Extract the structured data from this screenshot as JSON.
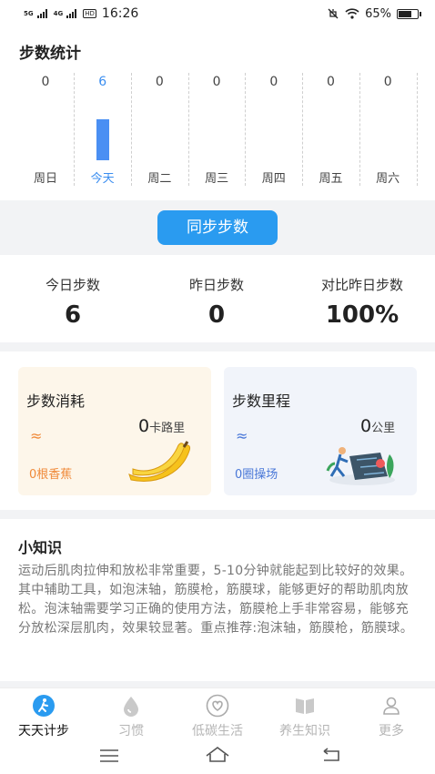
{
  "status_bar": {
    "signal1": "5G",
    "signal2": "4G",
    "hd": "HD",
    "time": "16:26",
    "battery": "65%"
  },
  "steps_section": {
    "title": "步数统计"
  },
  "chart_data": {
    "type": "bar",
    "categories": [
      "周日",
      "今天",
      "周二",
      "周三",
      "周四",
      "周五",
      "周六"
    ],
    "values": [
      0,
      6,
      0,
      0,
      0,
      0,
      0
    ],
    "value_labels": [
      "0",
      "6",
      "0",
      "0",
      "0",
      "0",
      "0"
    ],
    "active_index": 1,
    "accent": "#4a8ff3"
  },
  "sync": {
    "label": "同步步数"
  },
  "stats": [
    {
      "label": "今日步数",
      "value": "6"
    },
    {
      "label": "昨日步数",
      "value": "0"
    },
    {
      "label": "对比昨日步数",
      "value": "100%"
    }
  ],
  "cards": {
    "consume": {
      "title": "步数消耗",
      "wave": "≈",
      "value": "0",
      "unit": "卡路里",
      "sub": "0根香蕉",
      "color": "#f08a3a"
    },
    "distance": {
      "title": "步数里程",
      "wave": "≈",
      "value": "0",
      "unit": "公里",
      "sub": "0圈操场",
      "color": "#4a78d8"
    }
  },
  "tips": {
    "title": "小知识",
    "text": "运动后肌肉拉伸和放松非常重要，5-10分钟就能起到比较好的效果。其中辅助工具，如泡沫轴，筋膜枪，筋膜球，能够更好的帮助肌肉放松。泡沫轴需要学习正确的使用方法，筋膜枪上手非常容易，能够充分放松深层肌肉，效果较显著。重点推荐:泡沫轴，筋膜枪，筋膜球。"
  },
  "tabbar": [
    {
      "label": "天天计步",
      "icon": "walker-icon"
    },
    {
      "label": "习惯",
      "icon": "drop-icon"
    },
    {
      "label": "低碳生活",
      "icon": "heart-icon"
    },
    {
      "label": "养生知识",
      "icon": "book-icon"
    },
    {
      "label": "更多",
      "icon": "person-icon"
    }
  ],
  "colors": {
    "accent": "#2a9bf0",
    "band": "#f2f3f5"
  }
}
